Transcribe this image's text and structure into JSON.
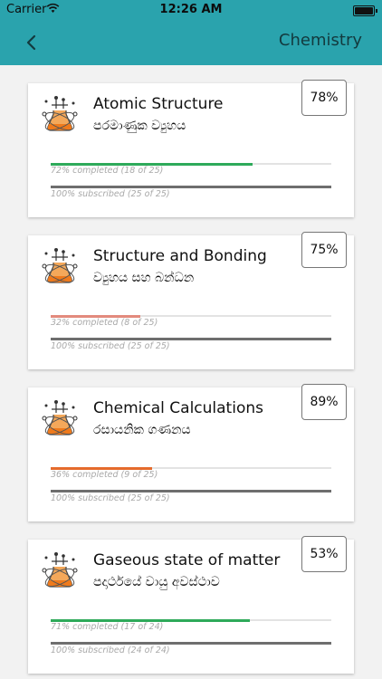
{
  "status_bar": {
    "carrier": "Carrier",
    "time": "12:26 AM"
  },
  "nav": {
    "title": "Chemistry"
  },
  "colors": {
    "header": "#2aa3ad",
    "green": "#2eaa5a",
    "red": "#e38a7d",
    "orange": "#e56b2c"
  },
  "lessons": [
    {
      "title": "Atomic Structure",
      "subtitle": "පරමාණුක ව්‍යුහය",
      "score": "78%",
      "progress_label": "72% completed (18 of 25)",
      "progress": 0.72,
      "progress_color": "#2eaa5a",
      "subscribed_label": "100% subscribed (25 of 25)",
      "icon": "chemistry-flask-icon"
    },
    {
      "title": "Structure and Bonding",
      "subtitle": "ව්‍යුහය සහ බන්ධන",
      "score": "75%",
      "progress_label": "32% completed (8 of 25)",
      "progress": 0.32,
      "progress_color": "#e38a7d",
      "subscribed_label": "100% subscribed (25 of 25)",
      "icon": "chemistry-flask-icon"
    },
    {
      "title": "Chemical Calculations",
      "subtitle": "රසායනික ගණනය",
      "score": "89%",
      "progress_label": "36% completed (9 of 25)",
      "progress": 0.36,
      "progress_color": "#e56b2c",
      "subscribed_label": "100% subscribed (25 of 25)",
      "icon": "chemistry-flask-icon"
    },
    {
      "title": "Gaseous state of matter",
      "subtitle": "පදාර්ථයේ වායු අවස්ථාව",
      "score": "53%",
      "progress_label": "71% completed (17 of 24)",
      "progress": 0.71,
      "progress_color": "#2eaa5a",
      "subscribed_label": "100% subscribed (24 of 24)",
      "icon": "chemistry-flask-icon"
    }
  ]
}
